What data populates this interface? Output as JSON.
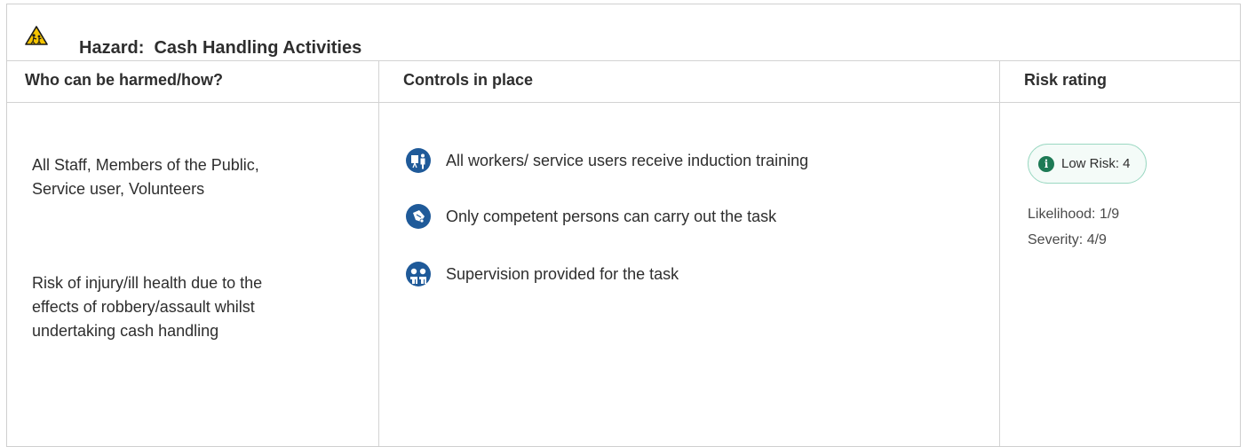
{
  "hazard": {
    "prefix": "Hazard:",
    "name": "Cash Handling Activities",
    "icon": "warning-triangle-icon"
  },
  "columns": {
    "who": "Who can be harmed/how?",
    "controls": "Controls in place",
    "risk": "Risk rating"
  },
  "who": {
    "people": "All Staff, Members of the Public, Service user, Volunteers",
    "description": "Risk of injury/ill health due to the effects of robbery/assault whilst undertaking cash handling"
  },
  "controls": [
    {
      "icon": "training-presentation-icon",
      "text": "All workers/ service users receive induction training"
    },
    {
      "icon": "competent-person-icon",
      "text": "Only competent persons can carry out the task"
    },
    {
      "icon": "supervision-group-icon",
      "text": "Supervision provided for the task"
    }
  ],
  "risk": {
    "label": "Low Risk: 4",
    "likelihood": "Likelihood: 1/9",
    "severity": "Severity: 4/9",
    "badge_color": "#1d7a55",
    "info_glyph": "i"
  },
  "colors": {
    "icon_blue": "#1f5a99",
    "warning_yellow": "#f5c400",
    "border": "#d3d3d3"
  }
}
